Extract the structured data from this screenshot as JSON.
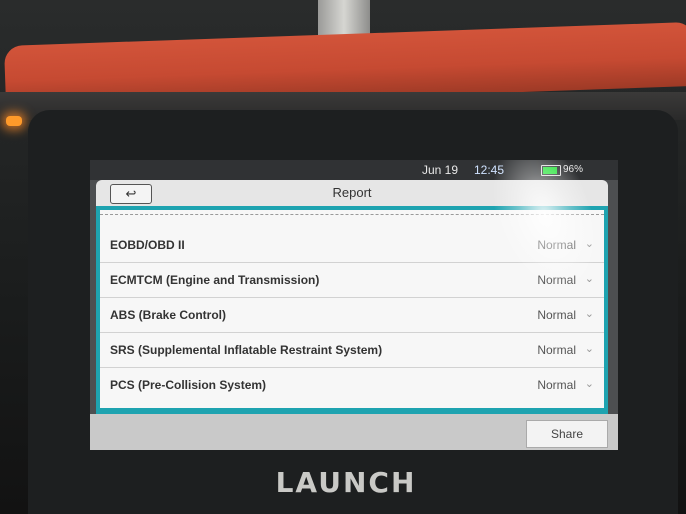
{
  "status_bar": {
    "date": "Jun 19",
    "time": "12:45",
    "battery_percent": "96%"
  },
  "header": {
    "title": "Report",
    "back_icon": "back-arrow-icon"
  },
  "report_items": [
    {
      "name": "EOBD/OBD II",
      "status": "Normal"
    },
    {
      "name": "ECMTCM (Engine and Transmission)",
      "status": "Normal"
    },
    {
      "name": "ABS (Brake Control)",
      "status": "Normal"
    },
    {
      "name": "SRS (Supplemental Inflatable Restraint System)",
      "status": "Normal"
    },
    {
      "name": "PCS (Pre-Collision System)",
      "status": "Normal"
    }
  ],
  "footer": {
    "share_label": "Share"
  },
  "device": {
    "brand": "LAUNCH"
  },
  "colors": {
    "accent": "#1ea3b0",
    "battery": "#27e23a",
    "bumper": "#c64a32"
  }
}
